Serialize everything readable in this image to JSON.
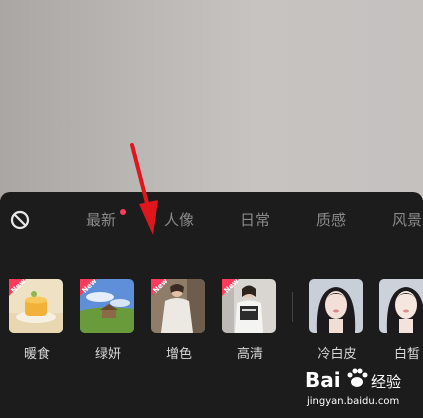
{
  "tabs": [
    {
      "label": "最新",
      "has_dot": true
    },
    {
      "label": "人像",
      "has_dot": false
    },
    {
      "label": "日常",
      "has_dot": false
    },
    {
      "label": "质感",
      "has_dot": false
    },
    {
      "label": "风景",
      "has_dot": false
    }
  ],
  "filters": [
    {
      "label": "暖食",
      "badge": "New"
    },
    {
      "label": "绿妍",
      "badge": "New"
    },
    {
      "label": "增色",
      "badge": "New"
    },
    {
      "label": "高清",
      "badge": "New"
    },
    {
      "label": "冷白皮",
      "badge": ""
    },
    {
      "label": "白皙",
      "badge": ""
    }
  ],
  "watermark": {
    "brand": "Bai",
    "brand2": "经验",
    "url": "jingyan.baidu.com"
  },
  "colors": {
    "badge": "#ff3b5c",
    "accent_arrow": "#e0161d"
  }
}
